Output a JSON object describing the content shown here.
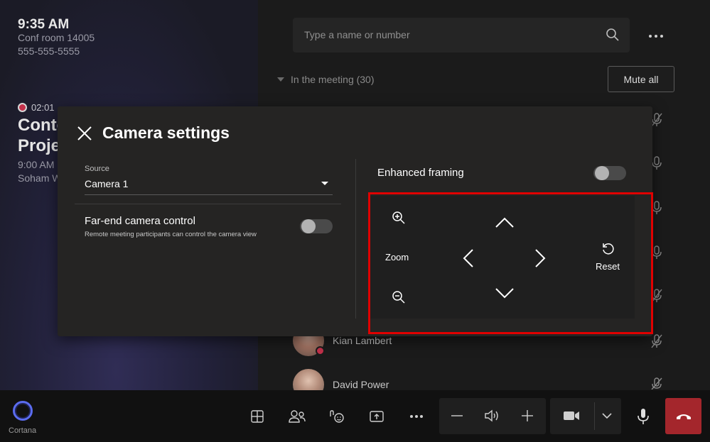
{
  "left_panel": {
    "clock": "9:35 AM",
    "room": "Conf room 14005",
    "phone": "555-555-5555",
    "recording_time": "02:01",
    "meeting_title_line1": "Conto",
    "meeting_title_line2": "Proje",
    "meeting_time": "9:00 AM",
    "organizer": "Soham W"
  },
  "right_panel": {
    "search": {
      "placeholder": "Type a name or number"
    },
    "in_meeting_label": "In the meeting (30)",
    "mute_all_label": "Mute all",
    "participants": [
      {
        "name": "Kian Lambert",
        "presence": "busy"
      },
      {
        "name": "David Power",
        "presence": "none"
      }
    ]
  },
  "dialog": {
    "title": "Camera settings",
    "source_label": "Source",
    "source_value": "Camera 1",
    "fecc_title": "Far-end camera control",
    "fecc_description": "Remote meeting participants can control the camera view",
    "fecc_enabled": false,
    "enhanced_framing_label": "Enhanced framing",
    "enhanced_framing_enabled": false,
    "zoom_label": "Zoom",
    "reset_label": "Reset"
  },
  "bottom_bar": {
    "cortana_label": "Cortana",
    "buttons": [
      "layout-icon",
      "people-icon",
      "reactions-icon",
      "share-icon",
      "more-icon",
      "volume-down-icon",
      "speaker-icon",
      "volume-up-icon",
      "camera-icon",
      "chevron-down-icon",
      "mic-icon",
      "hangup-icon"
    ]
  },
  "colors": {
    "accent_red": "#e00000",
    "hangup": "#a4262c",
    "presence_busy": "#c4314b"
  }
}
